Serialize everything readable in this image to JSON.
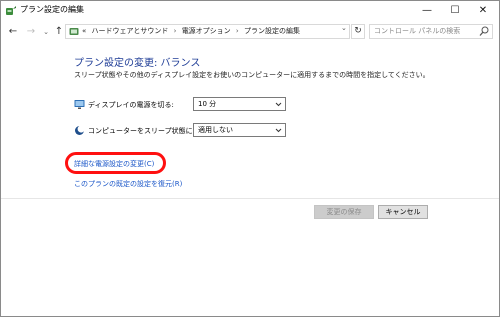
{
  "window": {
    "title": "プラン設定の編集",
    "minimize": "—",
    "maximize": "☐",
    "close": "✕"
  },
  "nav": {
    "back": "←",
    "forward": "→",
    "recent": "⌄",
    "up": "↑"
  },
  "address": {
    "prefix": "«",
    "breadcrumbs": [
      "ハードウェアとサウンド",
      "電源オプション",
      "プラン設定の編集"
    ],
    "separator": "›",
    "dropdown": "⌄",
    "refresh": "↻"
  },
  "search": {
    "placeholder": "コントロール パネルの検索"
  },
  "main": {
    "heading": "プラン設定の変更: バランス",
    "description": "スリープ状態やその他のディスプレイ設定をお使いのコンピューターに適用するまでの時間を指定してください。",
    "settings": [
      {
        "label": "ディスプレイの電源を切る:",
        "value": "10 分",
        "icon": "monitor-icon"
      },
      {
        "label": "コンピューターをスリープ状態にする:",
        "value": "適用しない",
        "icon": "moon-icon"
      }
    ],
    "advanced_link": "詳細な電源設定の変更(C)",
    "restore_link": "このプランの既定の設定を復元(R)"
  },
  "footer": {
    "save_label": "変更の保存",
    "cancel_label": "キャンセル"
  },
  "colors": {
    "heading": "#1e3c96",
    "link": "#1a56c8",
    "highlight": "#ff1010"
  }
}
